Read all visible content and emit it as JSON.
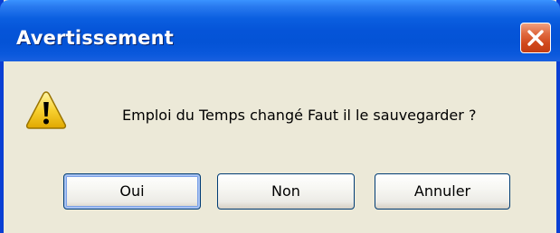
{
  "window": {
    "title": "Avertissement",
    "close_icon": "close-x-icon"
  },
  "message": {
    "icon": "warning-icon",
    "text": "Emploi du Temps changé Faut il le sauvegarder ?"
  },
  "buttons": {
    "yes_label": "Oui",
    "no_label": "Non",
    "cancel_label": "Annuler",
    "default": "yes"
  },
  "colors": {
    "titlebar": "#0554d8",
    "dialog_bg": "#ece9d8",
    "close_button": "#d0471b",
    "warning_icon": "#f8d030"
  }
}
